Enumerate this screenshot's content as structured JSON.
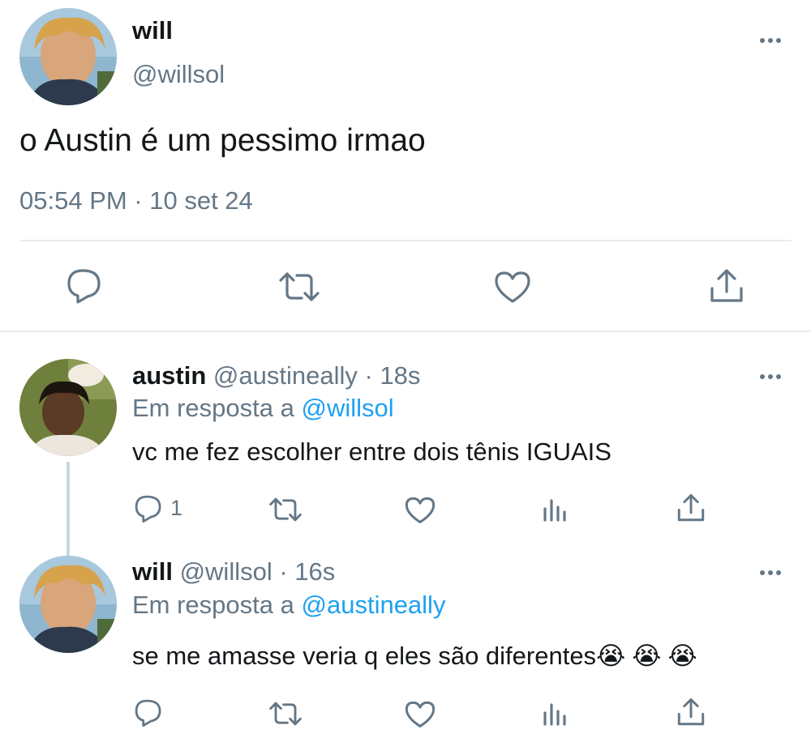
{
  "main_tweet": {
    "name": "will",
    "handle": "@willsol",
    "text": "o Austin é um pessimo irmao",
    "timestamp": "05:54 PM · 10 set 24",
    "actions": [
      "reply-icon",
      "retweet-icon",
      "like-icon",
      "share-icon"
    ]
  },
  "replies": [
    {
      "name": "austin",
      "handle": "@austineally",
      "time": "· 18s",
      "in_reply_prefix": "Em resposta a",
      "in_reply_handle": "@willsol",
      "text": "vc me fez escolher entre dois tênis IGUAIS",
      "reply_count": "1"
    },
    {
      "name": "will",
      "handle": "@willsol",
      "time": "· 16s",
      "in_reply_prefix": "Em resposta a",
      "in_reply_handle": "@austineally",
      "text": "se me amasse veria q eles são diferentes",
      "emoji": "😭😭😭"
    }
  ],
  "colors": {
    "text": "#14171a",
    "muted": "#657786",
    "accent": "#1da1f2",
    "divider": "#e6ecf0"
  }
}
